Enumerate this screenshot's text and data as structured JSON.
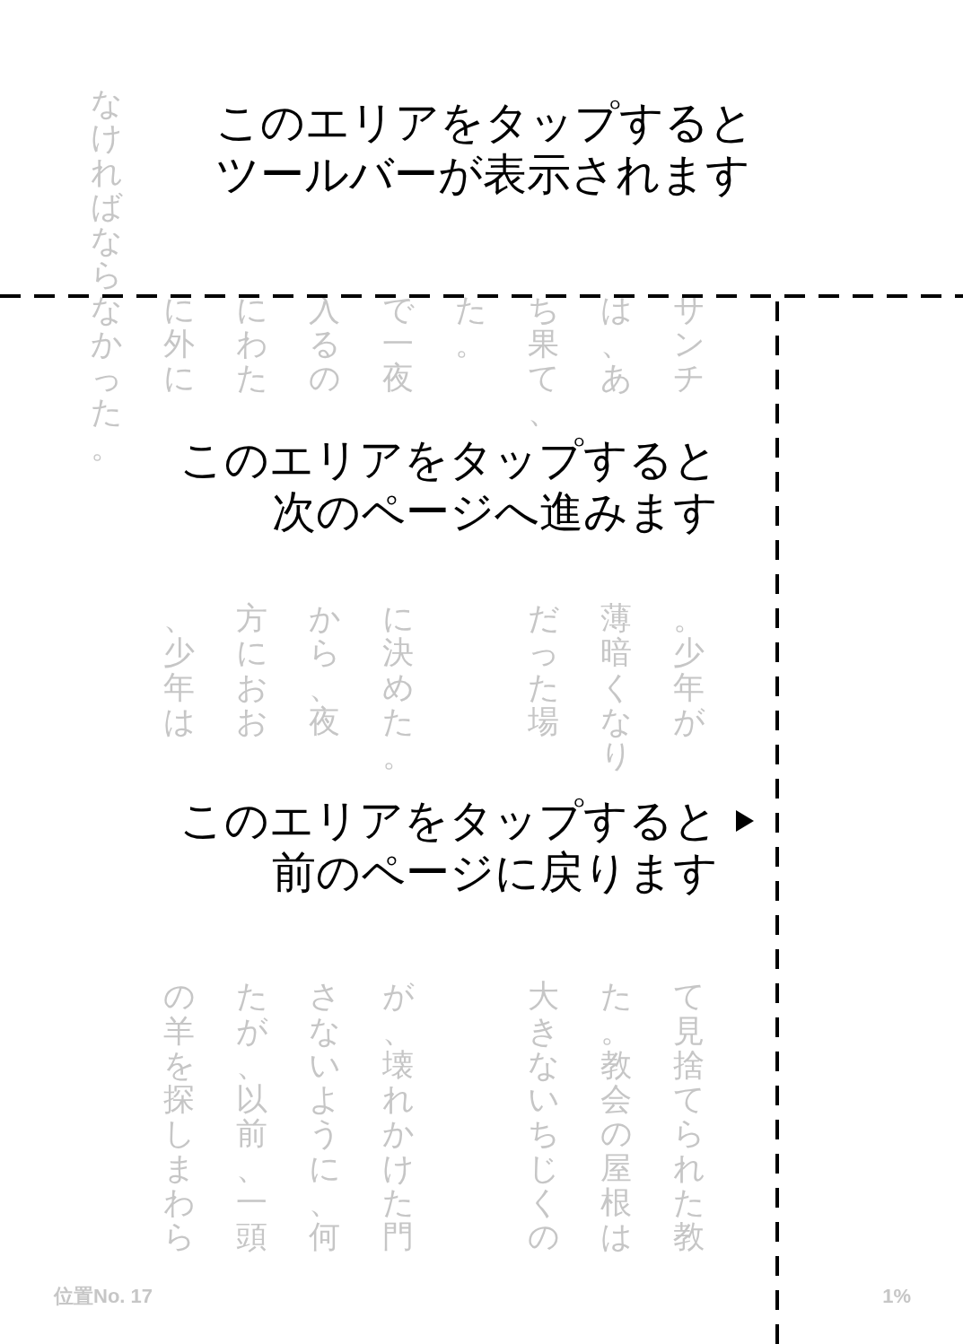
{
  "hints": [
    {
      "kind": "toolbar",
      "arrow": false,
      "lines": [
        "このエリアをタップすると",
        "ツールバーが表示されます"
      ]
    },
    {
      "kind": "next_page",
      "arrow": false,
      "lines": [
        "このエリアをタップすると",
        "次のページへ進みます"
      ]
    },
    {
      "kind": "previous_page",
      "arrow": true,
      "lines": [
        "このエリアをタップすると",
        "前のページに戻ります"
      ]
    }
  ],
  "page": {
    "columns": [
      {
        "kind": "full",
        "fragments": [
          "なければならなかった。"
        ]
      },
      {
        "kind": "split",
        "fragments": [
          "に外に",
          "、少年は",
          "の羊を探しまわら"
        ]
      },
      {
        "kind": "split",
        "fragments": [
          "にわた",
          "方におお",
          "たが、以前、一頭"
        ]
      },
      {
        "kind": "split",
        "fragments": [
          "入るの",
          "から、夜",
          "さないように、何"
        ]
      },
      {
        "kind": "split",
        "fragments": [
          "で一夜",
          "に決めた。",
          "が、壊れかけた門"
        ]
      },
      {
        "kind": "split",
        "fragments": [
          "た。"
        ]
      },
      {
        "kind": "split",
        "fragments": [
          "ち果て、",
          "だった場",
          "大きないちじくの"
        ]
      },
      {
        "kind": "split",
        "fragments": [
          "は、あ",
          "薄暗くなり",
          "た。教会の屋根は"
        ]
      },
      {
        "kind": "split",
        "fragments": [
          "サンチ",
          "。少年が",
          "て見捨てられた教"
        ]
      }
    ]
  },
  "footer": {
    "location": "位置No. 17",
    "progress": "1%"
  }
}
